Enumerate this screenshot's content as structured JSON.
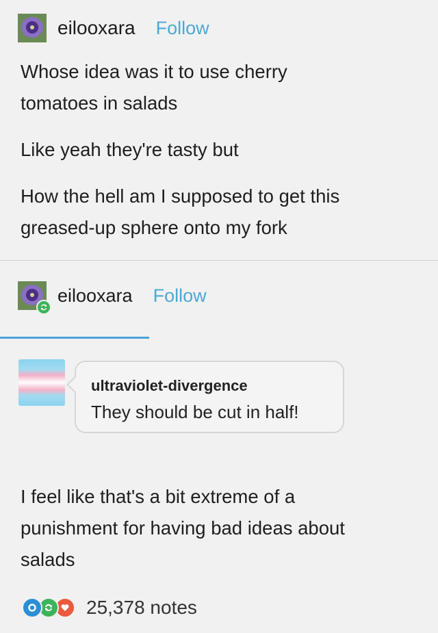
{
  "post1": {
    "username": "eilooxara",
    "follow_label": "Follow",
    "paragraphs": [
      "Whose idea was it to use cherry tomatoes in salads",
      "Like yeah they're tasty but",
      "How the hell am I supposed to get this greased-up sphere onto my fork"
    ]
  },
  "post2": {
    "username": "eilooxara",
    "follow_label": "Follow",
    "ask": {
      "asker": "ultraviolet-divergence",
      "text": "They should be cut in half!"
    },
    "answer": "I feel like that's a bit extreme of a punishment for having bad ideas about salads"
  },
  "footer": {
    "notes": "25,378 notes",
    "icons": [
      "comment-icon",
      "reblog-icon",
      "heart-icon"
    ]
  },
  "colors": {
    "follow": "#4aa9d4",
    "reblog_green": "#3db45b",
    "comment_blue": "#2c8fd6",
    "heart_red": "#ea5a3d",
    "divider_blue": "#4aa3d8"
  }
}
